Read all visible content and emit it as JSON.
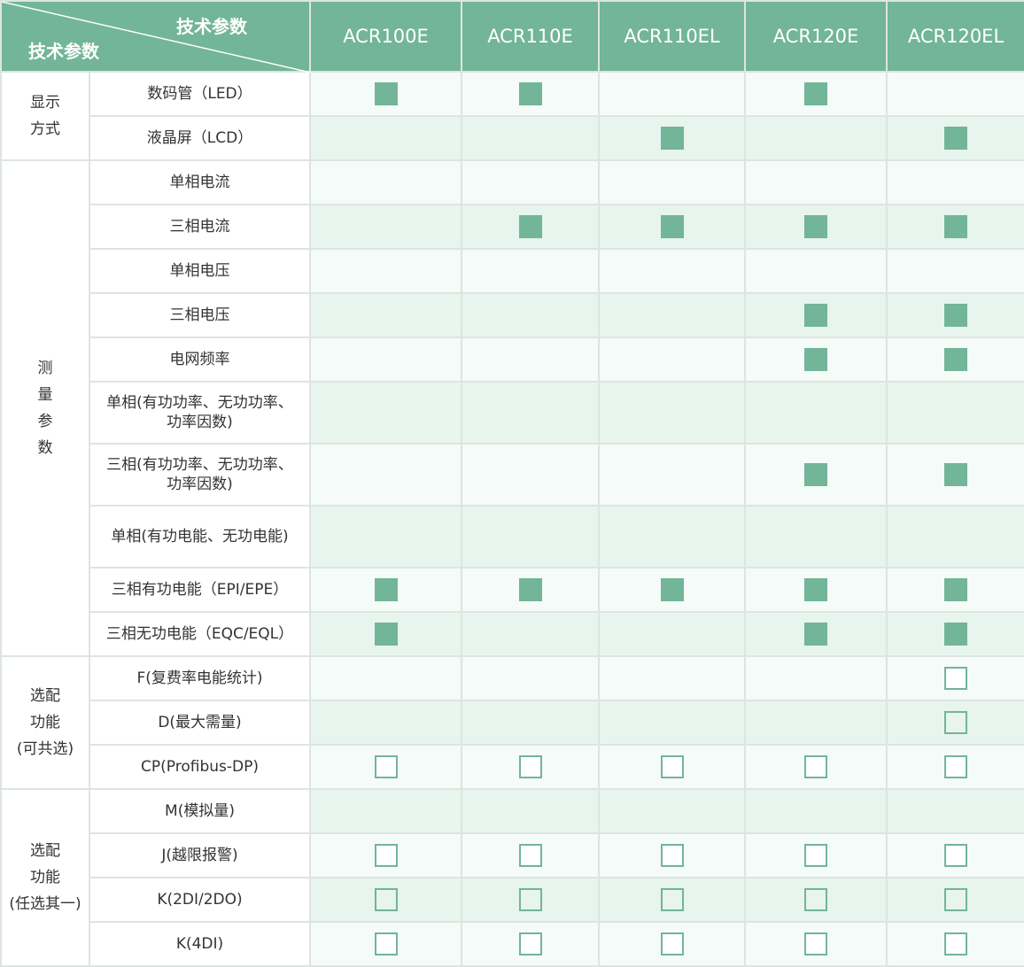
{
  "header": {
    "corner_top": "技术参数",
    "corner_bottom": "技术参数",
    "models": [
      "ACR100E",
      "ACR110E",
      "ACR110EL",
      "ACR120E",
      "ACR120EL"
    ]
  },
  "groups": [
    {
      "label_lines": [
        "显示",
        "方式"
      ]
    },
    {
      "label_lines": [
        "测",
        "量",
        "参",
        "数"
      ]
    },
    {
      "label_lines": [
        "选配",
        "功能",
        "(可共选)"
      ]
    },
    {
      "label_lines": [
        "选配",
        "功能",
        "(任选其一)"
      ]
    }
  ],
  "rows": [
    {
      "group": 0,
      "label_lines": [
        "数码管（LED）"
      ],
      "marks": [
        "filled",
        "filled",
        "",
        "filled",
        ""
      ]
    },
    {
      "group": 0,
      "label_lines": [
        "液晶屏（LCD）"
      ],
      "marks": [
        "",
        "",
        "filled",
        "",
        "filled"
      ]
    },
    {
      "group": 1,
      "label_lines": [
        "单相电流"
      ],
      "marks": [
        "",
        "",
        "",
        "",
        ""
      ]
    },
    {
      "group": 1,
      "label_lines": [
        "三相电流"
      ],
      "marks": [
        "",
        "filled",
        "filled",
        "filled",
        "filled"
      ]
    },
    {
      "group": 1,
      "label_lines": [
        "单相电压"
      ],
      "marks": [
        "",
        "",
        "",
        "",
        ""
      ]
    },
    {
      "group": 1,
      "label_lines": [
        "三相电压"
      ],
      "marks": [
        "",
        "",
        "",
        "filled",
        "filled"
      ]
    },
    {
      "group": 1,
      "label_lines": [
        "电网频率"
      ],
      "marks": [
        "",
        "",
        "",
        "filled",
        "filled"
      ]
    },
    {
      "group": 1,
      "label_lines": [
        "单相(有功功率、无功功率、",
        "功率因数)"
      ],
      "marks": [
        "",
        "",
        "",
        "",
        ""
      ]
    },
    {
      "group": 1,
      "label_lines": [
        "三相(有功功率、无功功率、",
        "功率因数)"
      ],
      "marks": [
        "",
        "",
        "",
        "filled",
        "filled"
      ]
    },
    {
      "group": 1,
      "label_lines": [
        "单相(有功电能、无功电能)"
      ],
      "marks": [
        "",
        "",
        "",
        "",
        ""
      ]
    },
    {
      "group": 1,
      "label_lines": [
        "三相有功电能（EPI/EPE）"
      ],
      "marks": [
        "filled",
        "filled",
        "filled",
        "filled",
        "filled"
      ]
    },
    {
      "group": 1,
      "label_lines": [
        "三相无功电能（EQC/EQL）"
      ],
      "marks": [
        "filled",
        "",
        "",
        "filled",
        "filled"
      ]
    },
    {
      "group": 2,
      "label_lines": [
        "F(复费率电能统计)"
      ],
      "marks": [
        "",
        "",
        "",
        "",
        "empty"
      ]
    },
    {
      "group": 2,
      "label_lines": [
        "D(最大需量)"
      ],
      "marks": [
        "",
        "",
        "",
        "",
        "empty"
      ]
    },
    {
      "group": 2,
      "label_lines": [
        "CP(Profibus-DP)"
      ],
      "marks": [
        "empty",
        "empty",
        "empty",
        "empty",
        "empty"
      ]
    },
    {
      "group": 3,
      "label_lines": [
        "M(模拟量)"
      ],
      "marks": [
        "",
        "",
        "",
        "",
        ""
      ]
    },
    {
      "group": 3,
      "label_lines": [
        "J(越限报警)"
      ],
      "marks": [
        "empty",
        "empty",
        "empty",
        "empty",
        "empty"
      ]
    },
    {
      "group": 3,
      "label_lines": [
        "K(2DI/2DO)"
      ],
      "marks": [
        "empty",
        "empty",
        "empty",
        "empty",
        "empty"
      ]
    },
    {
      "group": 3,
      "label_lines": [
        "K(4DI)"
      ],
      "marks": [
        "empty",
        "empty",
        "empty",
        "empty",
        "empty"
      ]
    }
  ],
  "colors": {
    "accent": "#72b598",
    "row_light": "#f5fbf8",
    "row_tint": "#e8f4ee"
  }
}
